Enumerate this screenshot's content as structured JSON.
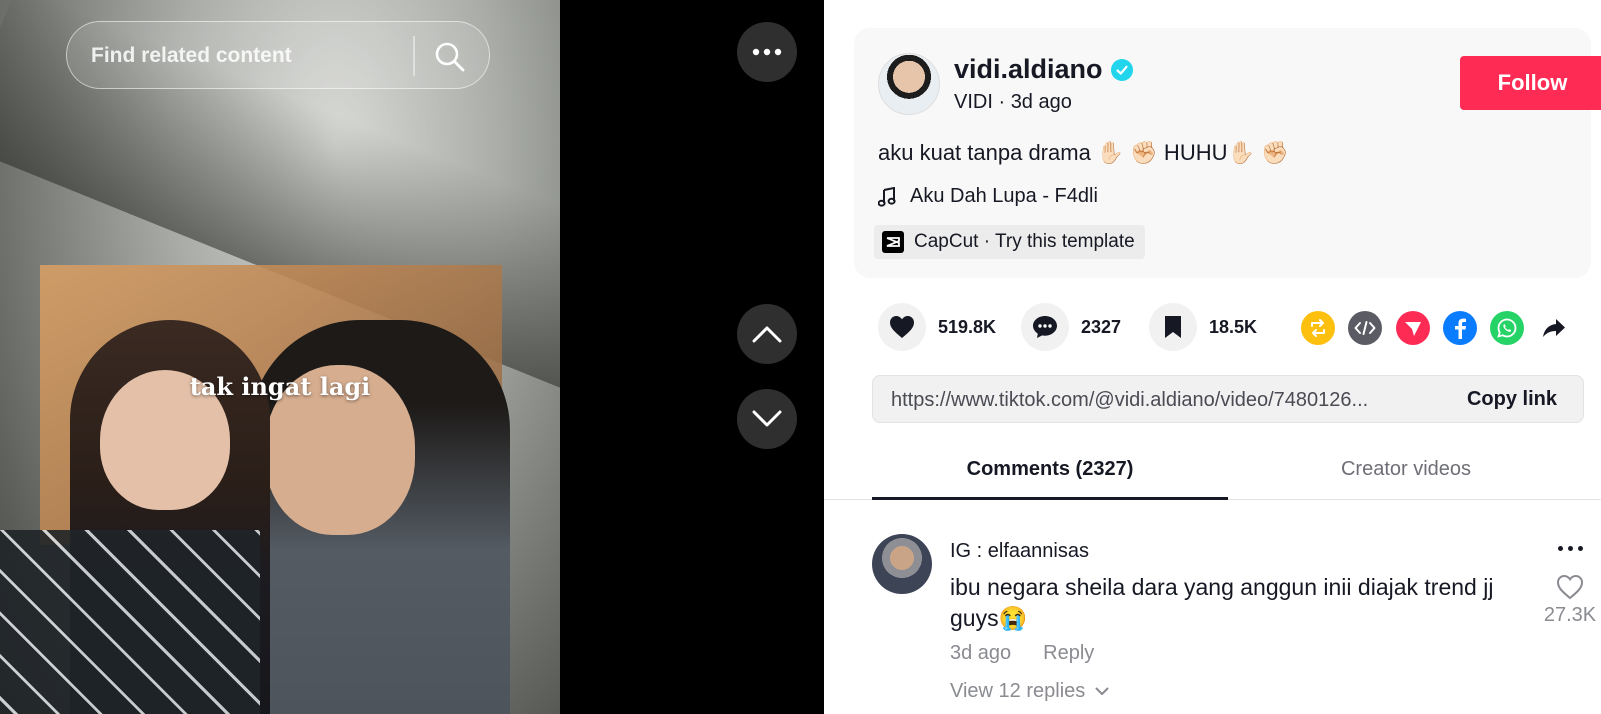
{
  "search": {
    "placeholder": "Find related content",
    "icon": "search-icon"
  },
  "video": {
    "overlay_text": "tak ingat lagi"
  },
  "author": {
    "username": "vidi.aldiano",
    "nickname": "VIDI",
    "posted": "3d ago",
    "separator": " · ",
    "verified": true,
    "follow_label": "Follow"
  },
  "post": {
    "caption": "aku kuat tanpa drama ✋🏻 ✊🏻 HUHU✋🏻 ✊🏻",
    "music": "Aku Dah Lupa - F4dli",
    "template": "CapCut · Try this template"
  },
  "stats": {
    "likes": "519.8K",
    "comments": "2327",
    "saves": "18.5K"
  },
  "share": {
    "icons": [
      "repost-icon",
      "embed-icon",
      "send-icon",
      "facebook-icon",
      "whatsapp-icon",
      "share-arrow-icon"
    ],
    "colors": {
      "repost": "#fdc00f",
      "embed": "#5a5b63",
      "send": "#fe2c55",
      "facebook": "#0a7cff",
      "whatsapp": "#25d366"
    }
  },
  "link": {
    "url": "https://www.tiktok.com/@vidi.aldiano/video/7480126...",
    "copy_label": "Copy link"
  },
  "tabs": {
    "comments": "Comments (2327)",
    "creator_videos": "Creator videos"
  },
  "comments": [
    {
      "user": "IG : elfaannisas",
      "text": "ibu negara sheila dara yang anggun inii diajak trend jj guys😭",
      "time": "3d ago",
      "reply_label": "Reply",
      "likes": "27.3K",
      "view_replies": "View 12 replies"
    }
  ],
  "colors": {
    "accent": "#fe2c55",
    "verified": "#20d5ec",
    "text": "#161823",
    "muted": "#8a8b91"
  }
}
